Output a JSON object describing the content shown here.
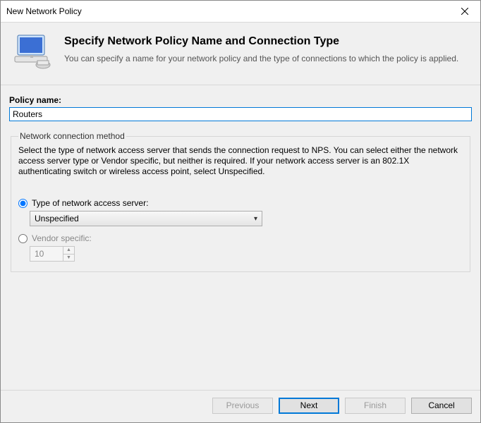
{
  "window": {
    "title": "New Network Policy"
  },
  "header": {
    "heading": "Specify Network Policy Name and Connection Type",
    "subheading": "You can specify a name for your network policy and the type of connections to which the policy is applied."
  },
  "policy": {
    "label": "Policy name:",
    "value": "Routers"
  },
  "group": {
    "legend": "Network connection method",
    "description": "Select the type of network access server that sends the connection request to NPS. You can select either the network access server type or Vendor specific, but neither is required.  If your network access server is an 802.1X authenticating switch or wireless access point, select Unspecified.",
    "radio_type_label": "Type of network access server:",
    "select_value": "Unspecified",
    "radio_vendor_label": "Vendor specific:",
    "vendor_value": "10",
    "selected_radio": "type"
  },
  "footer": {
    "previous": "Previous",
    "next": "Next",
    "finish": "Finish",
    "cancel": "Cancel"
  }
}
